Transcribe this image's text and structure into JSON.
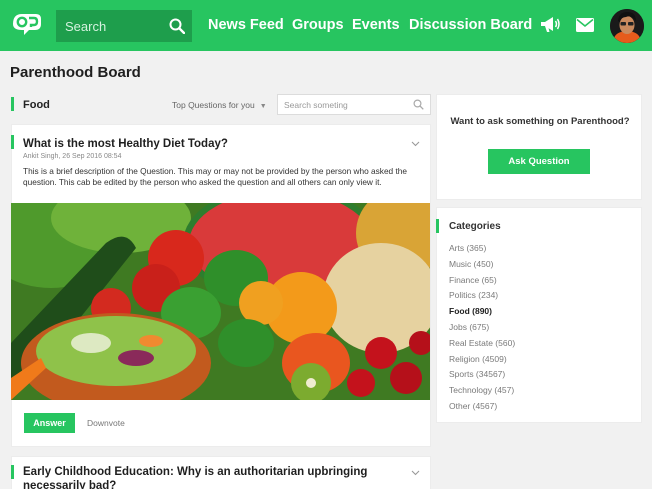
{
  "header": {
    "search_placeholder": "Search",
    "nav": [
      "News Feed",
      "Groups",
      "Events",
      "Discussion Board"
    ]
  },
  "page_title": "Parenthood Board",
  "filter": {
    "section": "Food",
    "sort_label": "Top Questions for you",
    "search_placeholder": "Search someting"
  },
  "questions": [
    {
      "title": "What is the most Healthy Diet Today?",
      "meta": "Ankit Singh, 26 Sep 2016 08:54",
      "description": "This is a brief description of the Question. This may or may not be provided by the person who asked the question. This cab be edited by the person who asked the question and all others can only view it.",
      "answer_label": "Answer",
      "downvote_label": "Downvote"
    },
    {
      "title": "Early Childhood Education: Why is an authoritarian upbringing necessarily bad?"
    }
  ],
  "ask": {
    "prompt": "Want to ask something on Parenthood?",
    "button_label": "Ask Question"
  },
  "categories": {
    "title": "Categories",
    "items": [
      {
        "label": "Arts (365)",
        "active": false
      },
      {
        "label": "Music (450)",
        "active": false
      },
      {
        "label": "Finance (65)",
        "active": false
      },
      {
        "label": "Politics (234)",
        "active": false
      },
      {
        "label": "Food (890)",
        "active": true
      },
      {
        "label": "Jobs (675)",
        "active": false
      },
      {
        "label": "Real Estate (560)",
        "active": false
      },
      {
        "label": "Religion (4509)",
        "active": false
      },
      {
        "label": "Sports (34567)",
        "active": false
      },
      {
        "label": "Technology (457)",
        "active": false
      },
      {
        "label": "Other (4567)",
        "active": false
      }
    ]
  },
  "colors": {
    "accent": "#27c560",
    "accent_dark": "#1e9e4c"
  }
}
